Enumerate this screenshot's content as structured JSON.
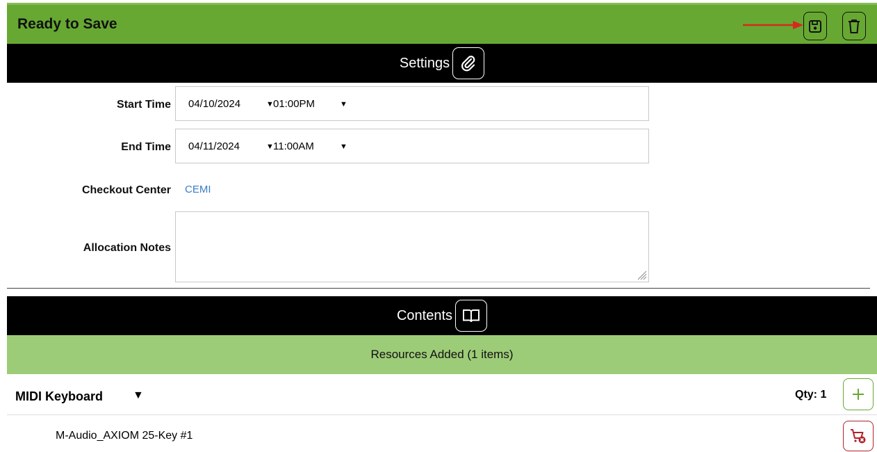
{
  "header": {
    "title": "Ready to Save",
    "save_icon": "floppy-disk-icon",
    "delete_icon": "trash-icon",
    "accent": "#67a832"
  },
  "settings": {
    "title": "Settings",
    "icon": "paperclip-icon"
  },
  "form": {
    "start_time": {
      "label": "Start Time",
      "date": "04/10/2024",
      "time": "01:00PM"
    },
    "end_time": {
      "label": "End Time",
      "date": "04/11/2024",
      "time": "11:00AM"
    },
    "checkout_center": {
      "label": "Checkout Center",
      "value": "CEMI"
    },
    "allocation_notes": {
      "label": "Allocation Notes",
      "value": ""
    }
  },
  "contents": {
    "title": "Contents",
    "icon": "book-icon",
    "resources_added": "Resources Added (1 items)",
    "groups": [
      {
        "name": "MIDI Keyboard",
        "qty_label": "Qty: 1",
        "items": [
          "M-Audio_AXIOM 25-Key #1"
        ]
      }
    ]
  },
  "colors": {
    "header_green": "#67a832",
    "band_green": "#9dcc78",
    "link_blue": "#3a7dc6",
    "remove_red": "#b0232a"
  }
}
